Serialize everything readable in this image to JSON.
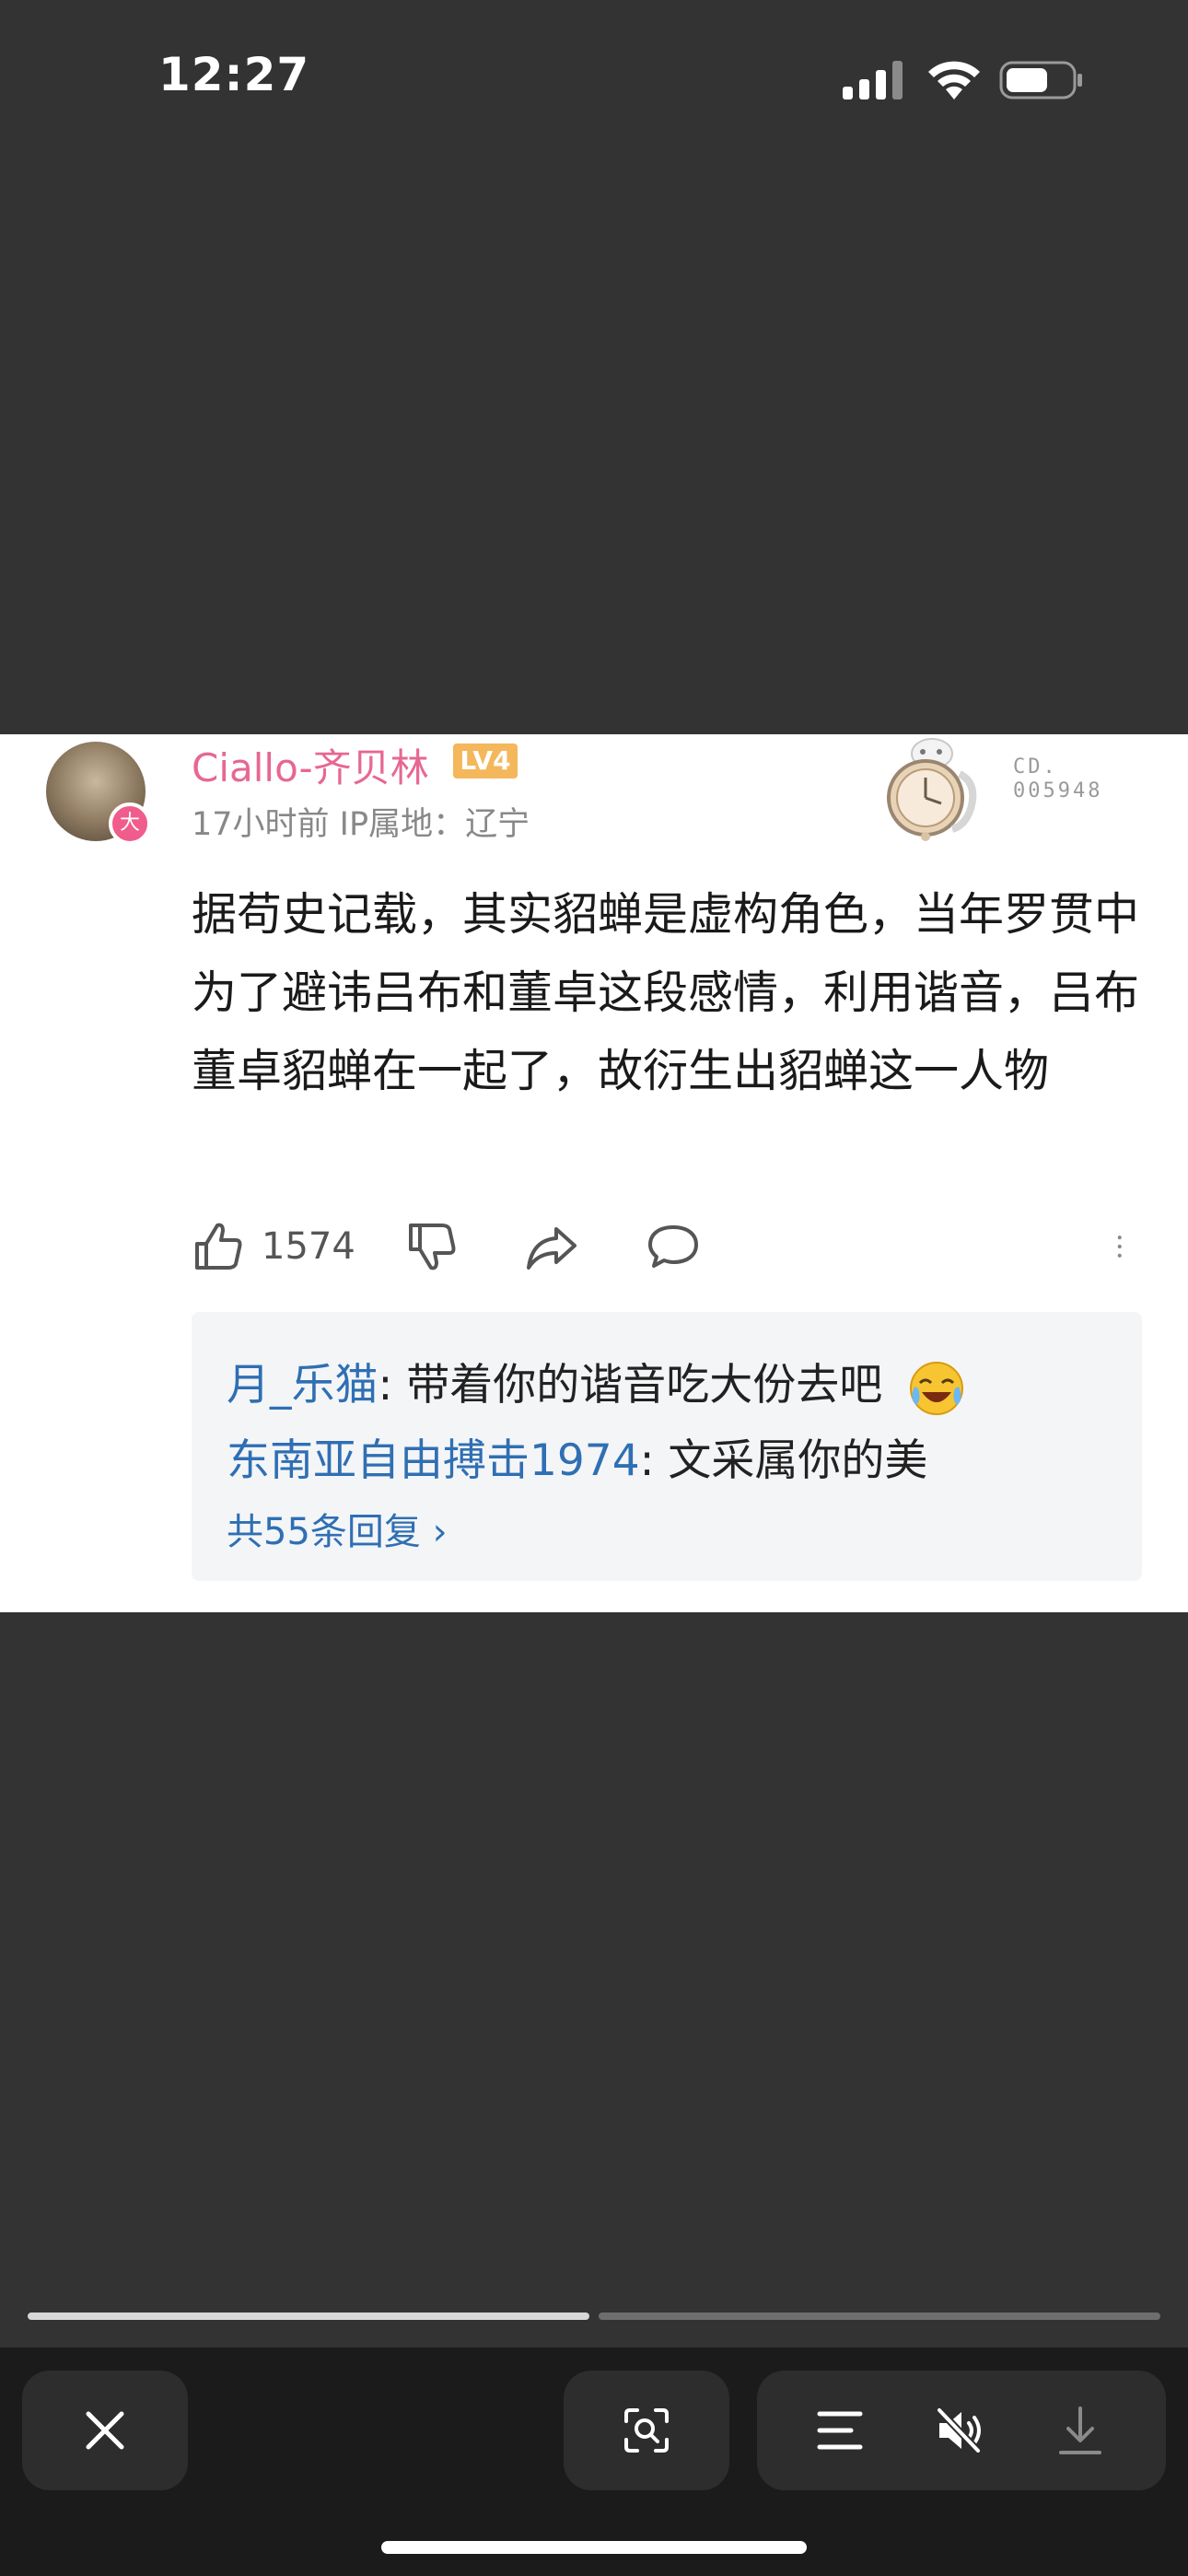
{
  "status_bar": {
    "time": "12:27"
  },
  "comment": {
    "username": "Ciallo-齐贝林",
    "level": "LV4",
    "avatar_badge": "大",
    "meta": "17小时前 IP属地：辽宁",
    "fan_number_line1": "CD.",
    "fan_number_line2": "005948",
    "text": "据苟史记载，其实貂蝉是虚构角色，当年罗贯中为了避讳吕布和董卓这段感情，利用谐音，吕布董卓貂蝉在一起了，故衍生出貂蝉这一人物",
    "like_count": "1574"
  },
  "replies": {
    "items": [
      {
        "name": "月_乐猫",
        "text": ": 带着你的谐音吃大份去吧"
      },
      {
        "name": "东南亚自由搏击1974",
        "text": ": 文采属你的美"
      }
    ],
    "more_label": "共55条回复 ›"
  },
  "viewer": {
    "progress": [
      1.0,
      0.0
    ]
  },
  "colors": {
    "background": "#333333",
    "username": "#e66892",
    "reply_name": "#2f6fb3",
    "level_badge": "#f4b75c"
  },
  "icons": [
    "signal-icon",
    "wifi-icon",
    "battery-icon",
    "like-icon",
    "dislike-icon",
    "share-icon",
    "comment-icon",
    "more-icon",
    "close-icon",
    "visual-lookup-icon",
    "text-menu-icon",
    "mute-icon",
    "download-icon"
  ]
}
